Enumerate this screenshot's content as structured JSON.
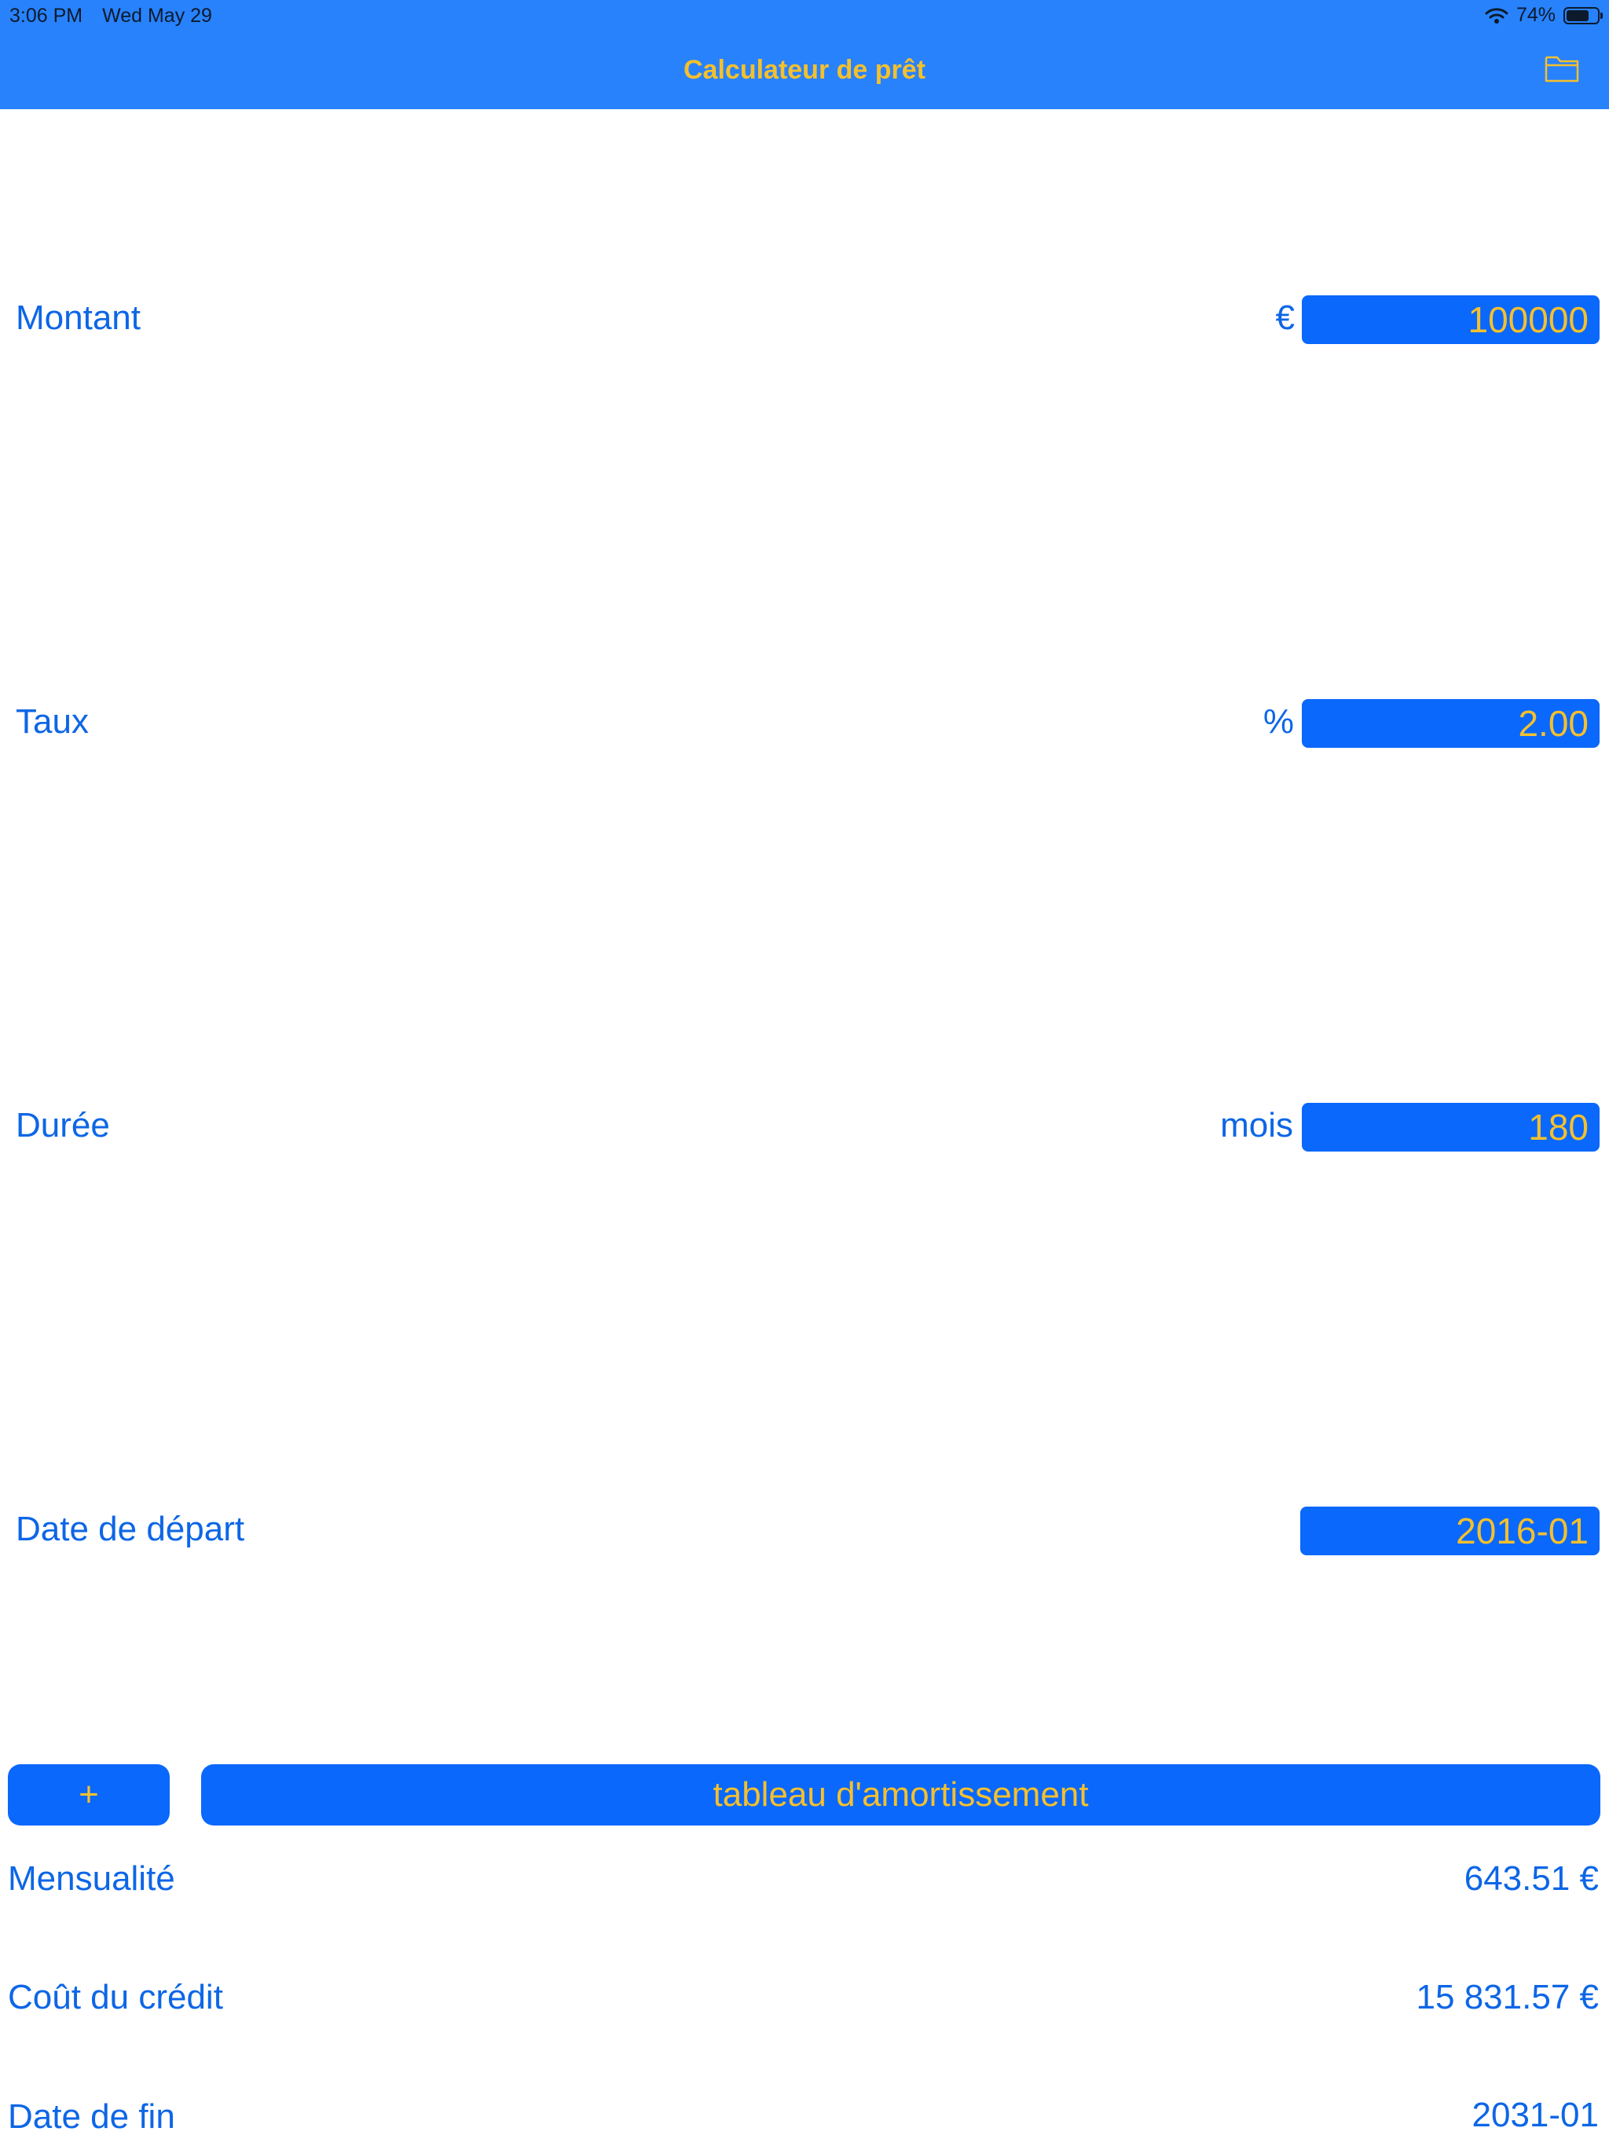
{
  "status_bar": {
    "time": "3:06 PM",
    "date": "Wed May 29",
    "battery_text": "74%",
    "battery_level": 0.74
  },
  "nav": {
    "title": "Calculateur de prêt",
    "folder_icon": "folder-icon"
  },
  "form": {
    "amount": {
      "label": "Montant",
      "unit": "€",
      "value": "100000"
    },
    "rate": {
      "label": "Taux",
      "unit": "%",
      "value": "2.00"
    },
    "duration": {
      "label": "Durée",
      "unit": "mois",
      "value": "180"
    },
    "start_date": {
      "label": "Date de départ",
      "value": "2016-01"
    }
  },
  "actions": {
    "add_label": "+",
    "amortization_label": "tableau d'amortissement"
  },
  "results": {
    "monthly": {
      "label": "Mensualité",
      "value": "643.51 €"
    },
    "cost": {
      "label": "Coût du crédit",
      "value": "15 831.57 €"
    },
    "end_date": {
      "label": "Date de fin",
      "value": "2031-01"
    }
  },
  "colors": {
    "nav_background": "#2882fc",
    "accent_yellow": "#f4c02d",
    "field_background": "#0a68fc",
    "text_blue": "#0d66e6"
  }
}
